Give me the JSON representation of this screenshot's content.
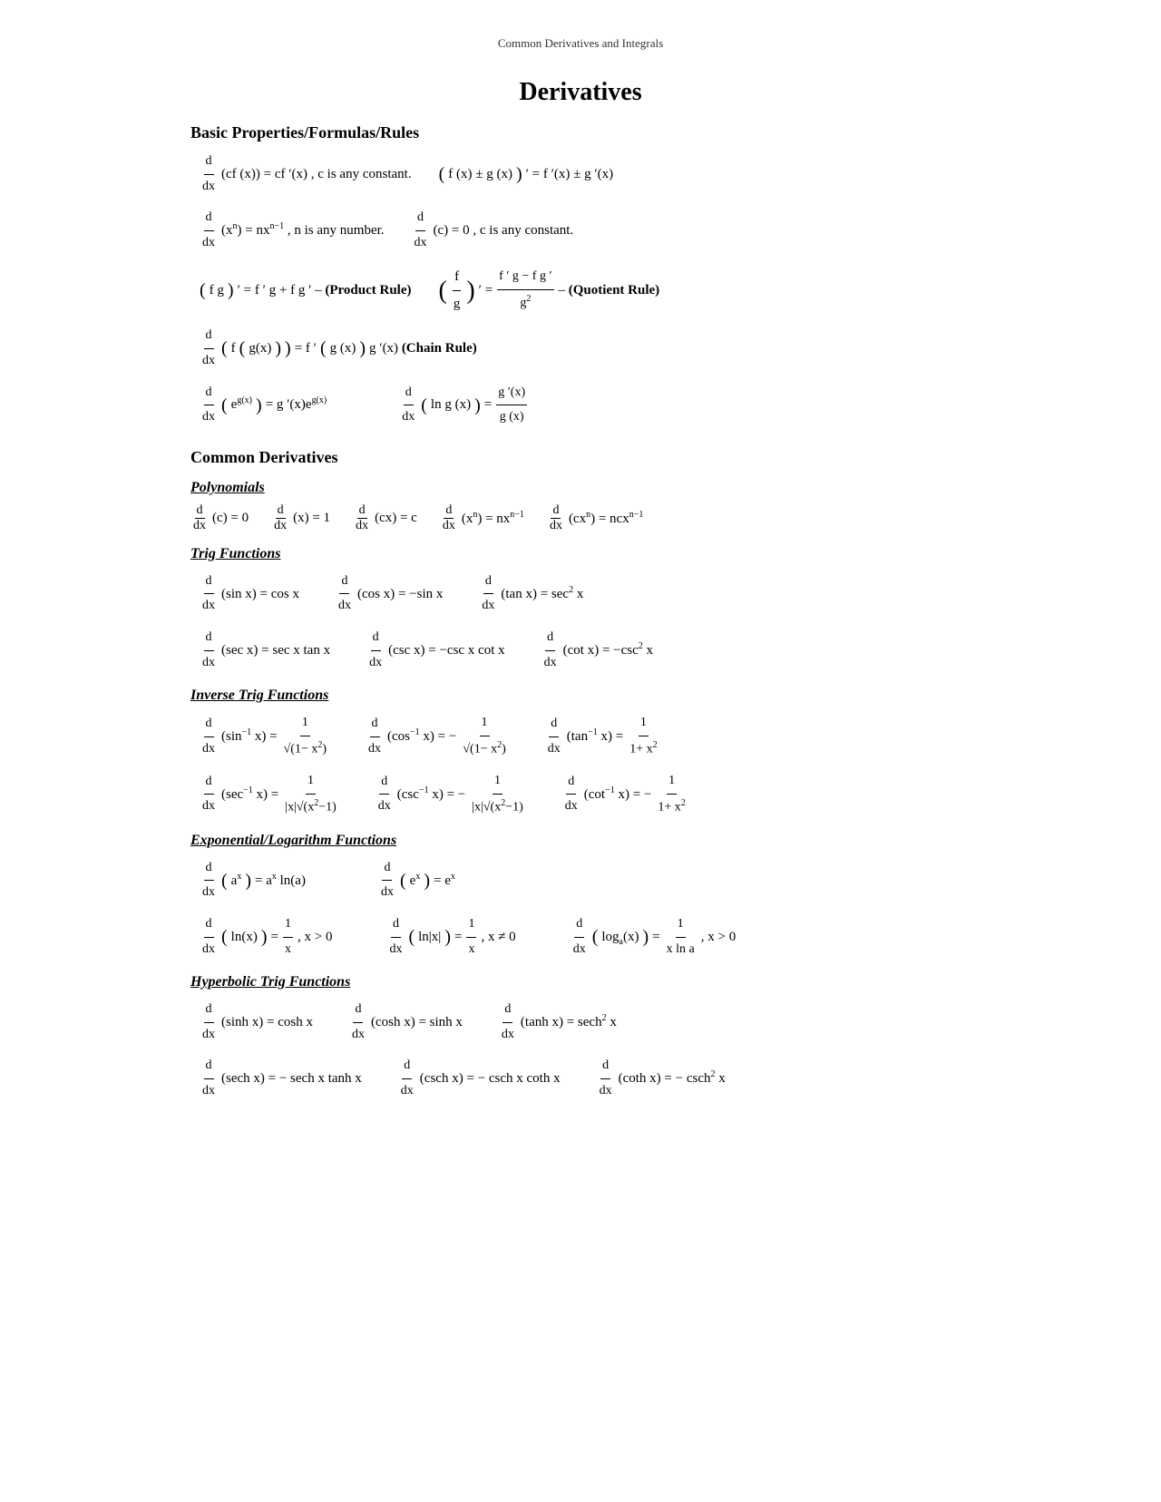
{
  "header": {
    "title": "Common Derivatives and Integrals"
  },
  "content": {
    "main_title": "Derivatives",
    "sections": [
      {
        "title": "Basic Properties/Formulas/Rules"
      },
      {
        "title": "Common Derivatives",
        "subsections": [
          {
            "title": "Polynomials"
          },
          {
            "title": "Trig Functions"
          },
          {
            "title": "Inverse Trig Functions"
          },
          {
            "title": "Exponential/Logarithm Functions"
          },
          {
            "title": "Hyperbolic Trig Functions"
          }
        ]
      }
    ]
  }
}
